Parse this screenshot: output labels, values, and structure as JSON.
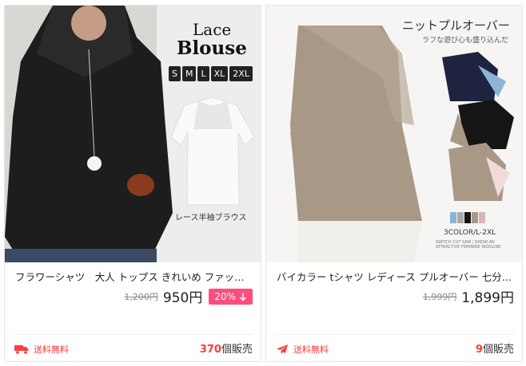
{
  "products": [
    {
      "title": "フラワーシャツ　大人 トップス きれいめ ファッショ...",
      "old_price": "1,200円",
      "price": "950円",
      "discount": "20%",
      "discount_icon": "arrow-down-icon",
      "shipping_label": "送料無料",
      "shipping_icon": "truck-icon",
      "sold_count": "370",
      "sold_suffix": "個販売",
      "image_text": {
        "line1": "Lace",
        "line2": "Blouse",
        "sizes": [
          "S",
          "M",
          "L",
          "XL",
          "2XL"
        ],
        "caption": "レース半袖ブラウス"
      }
    },
    {
      "title": "バイカラー tシャツ レディース プルオーバー 七分袖 ...",
      "old_price": "1,999円",
      "price": "1,899円",
      "shipping_label": "送料無料",
      "shipping_icon": "airplane-icon",
      "sold_count": "9",
      "sold_suffix": "個販売",
      "image_text": {
        "headline": "ニットプルオーバー",
        "subline": "ラフな遊び心も盛り込んだ",
        "colors_label": "3COLOR/L-2XL",
        "fine_print": "SWITCH CUT SAW / SHOW AN ATTRACTIVE FEMININE WOOLINE"
      }
    }
  ],
  "colors": {
    "accent": "#ff4d7d",
    "shipping": "#ff3b3b"
  }
}
